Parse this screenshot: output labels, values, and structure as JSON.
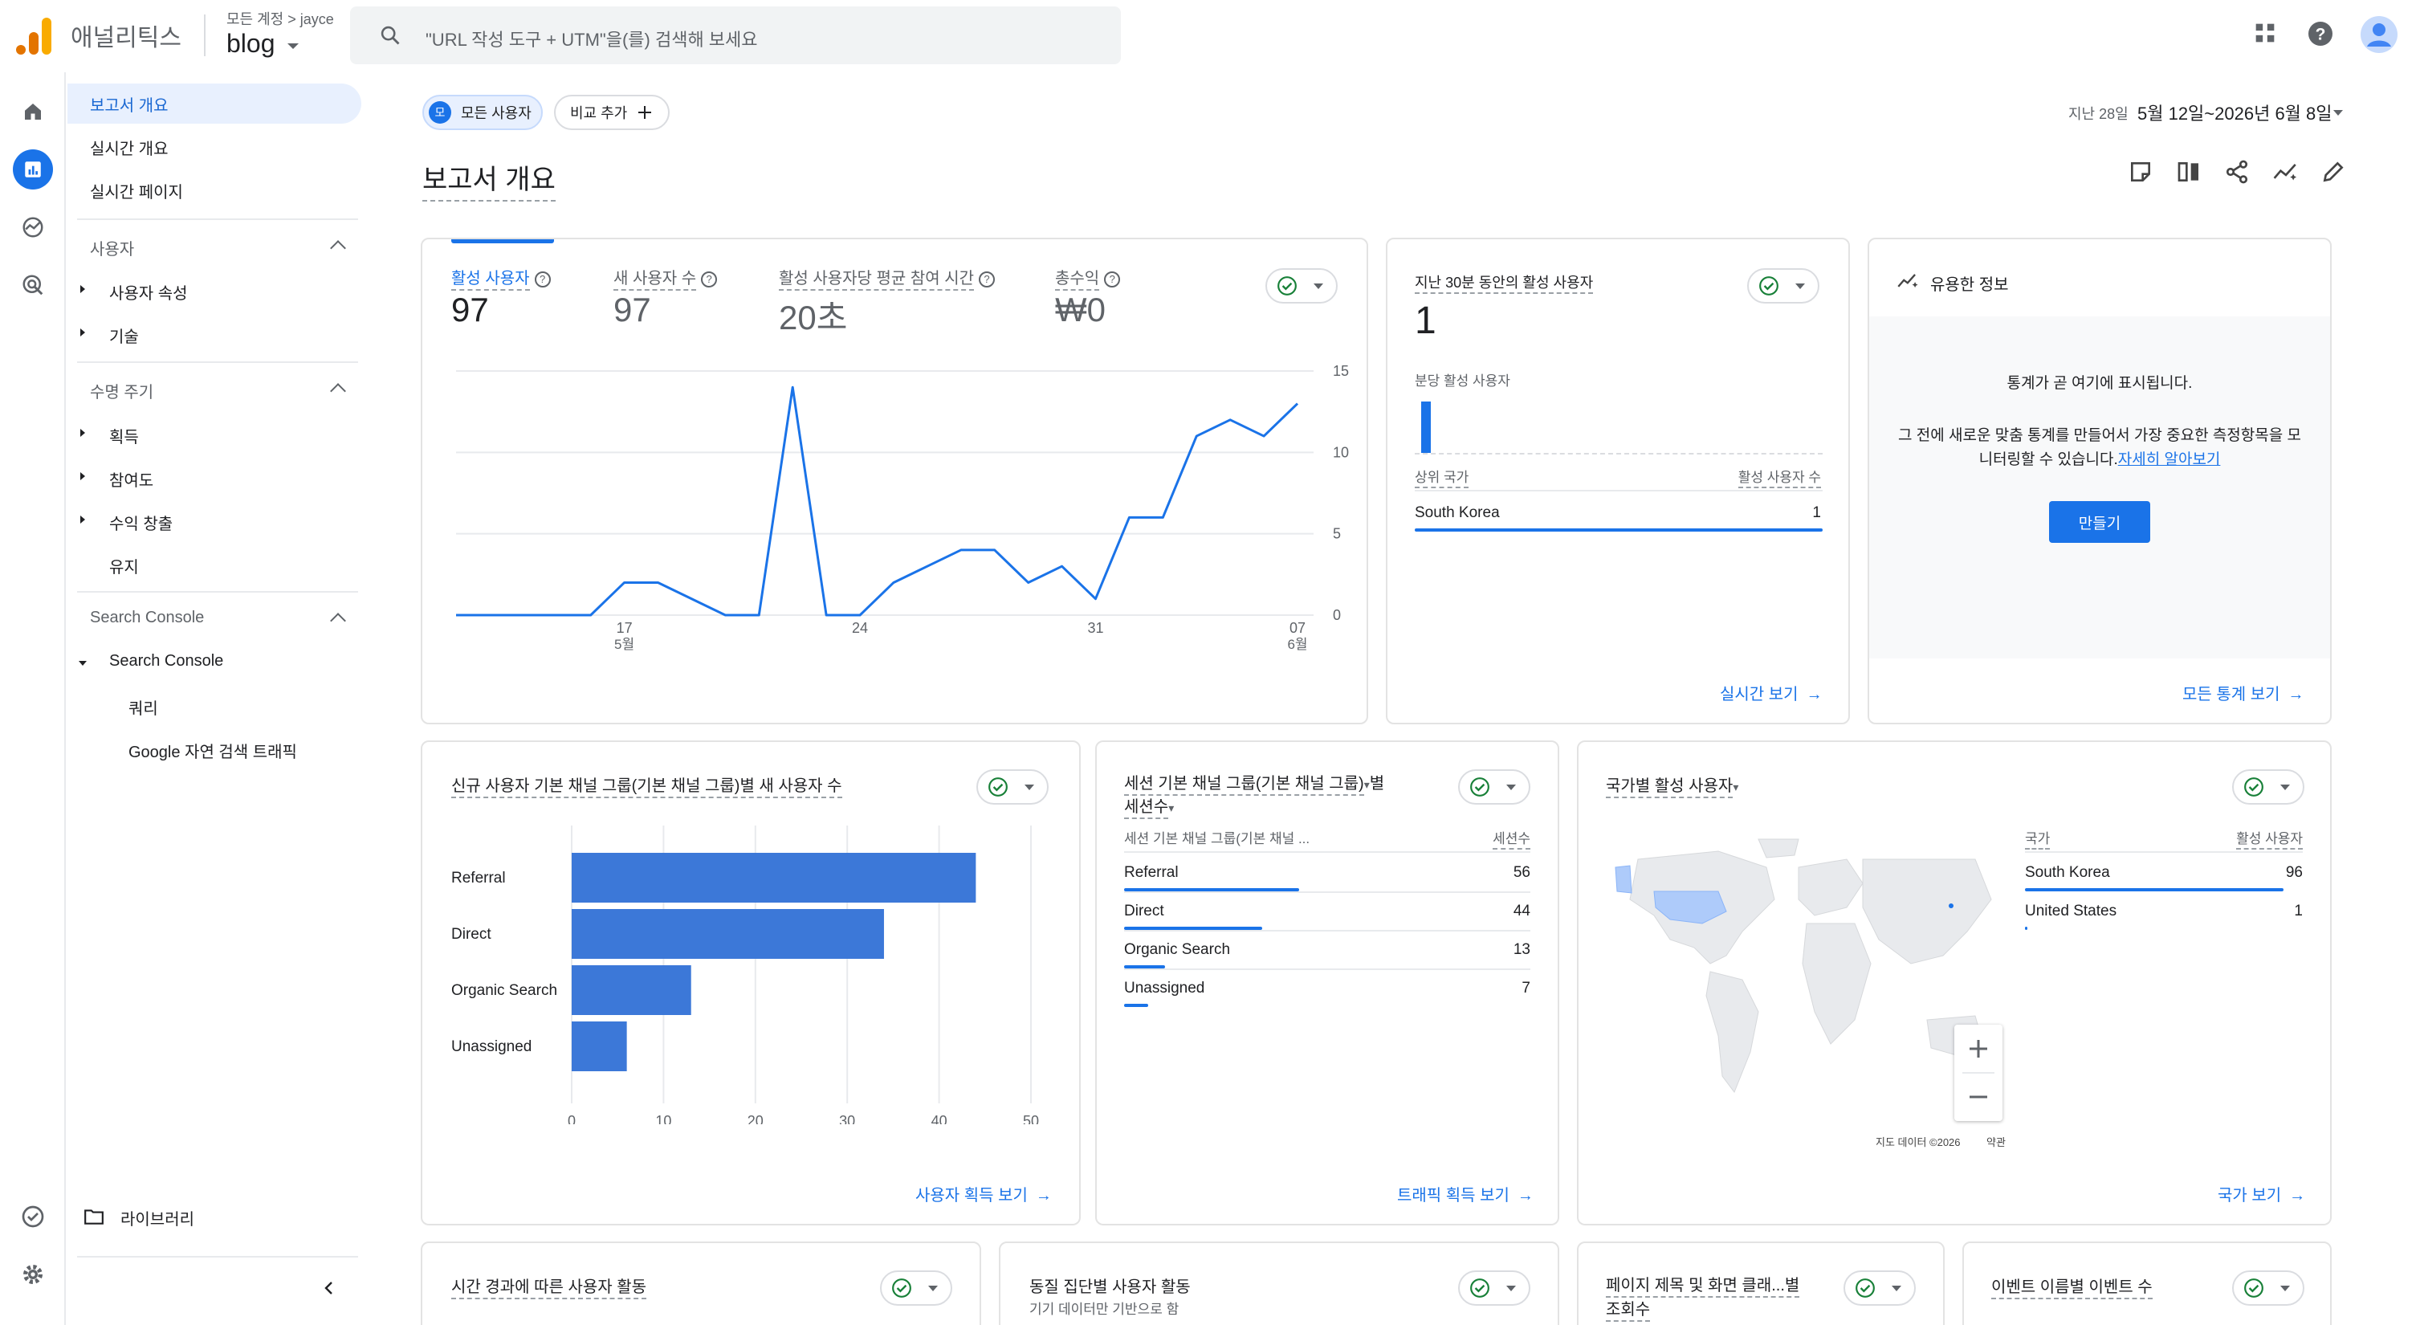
{
  "app": {
    "name": "애널리틱스",
    "account_path": "모든 계정 > jayce",
    "property": "blog"
  },
  "search": {
    "placeholder": "\"URL 작성 도구 + UTM\"을(를) 검색해 보세요"
  },
  "icons": {
    "apps": "apps-grid-icon",
    "help": "help-icon",
    "account": "account-avatar-icon"
  },
  "rail": [
    "home-icon",
    "reports-icon",
    "explore-icon",
    "advertising-icon"
  ],
  "nav": {
    "report_overview": "보고서 개요",
    "realtime_overview": "실시간 개요",
    "realtime_pages": "실시간 페이지",
    "users_section": "사용자",
    "user_attributes": "사용자 속성",
    "tech": "기술",
    "lifecycle_section": "수명 주기",
    "acquisition": "획득",
    "engagement": "참여도",
    "monetization": "수익 창출",
    "retention": "유지",
    "sc_section": "Search Console",
    "sc_item": "Search Console",
    "queries": "쿼리",
    "organic": "Google 자연 검색 트래픽",
    "library": "라이브러리"
  },
  "toolbar": {
    "segment_badge": "모",
    "segment": "모든 사용자",
    "compare": "비교 추가",
    "date_label": "지난 28일",
    "date_range": "5월 12일~2026년 6월 8일"
  },
  "page_title": "보고서 개요",
  "colors": {
    "accent": "#1a73e8",
    "check": "#188038",
    "map_highlight": "#aecbfa"
  },
  "main_card": {
    "metrics": [
      {
        "label": "활성 사용자",
        "value": "97"
      },
      {
        "label": "새 사용자 수",
        "value": "97"
      },
      {
        "label": "활성 사용자당 평균 참여 시간",
        "value": "20초"
      },
      {
        "label": "총수익",
        "value": "₩0"
      }
    ],
    "x_ticks": [
      {
        "day": "17",
        "month": "5월"
      },
      {
        "day": "24",
        "month": ""
      },
      {
        "day": "31",
        "month": ""
      },
      {
        "day": "07",
        "month": "6월"
      }
    ]
  },
  "chart_data": [
    {
      "type": "line",
      "series": [
        {
          "name": "활성 사용자",
          "values": [
            0,
            0,
            0,
            0,
            0,
            2,
            2,
            1,
            0,
            0,
            14,
            0,
            0,
            2,
            3,
            4,
            4,
            2,
            3,
            1,
            6,
            6,
            11,
            12,
            11,
            13
          ]
        }
      ],
      "x": [
        "5월 12일",
        "5월 13일",
        "5월 14일",
        "5월 15일",
        "5월 16일",
        "5월 17일",
        "5월 18일",
        "5월 19일",
        "5월 20일",
        "5월 21일",
        "5월 22일",
        "5월 23일",
        "5월 24일",
        "5월 25일",
        "5월 26일",
        "5월 27일",
        "5월 28일",
        "5월 29일",
        "5월 30일",
        "5월 31일",
        "6월 1일",
        "6월 2일",
        "6월 3일",
        "6월 4일",
        "6월 5일",
        "6월 6일"
      ],
      "ylim": [
        0,
        15
      ],
      "y_ticks": [
        "15",
        "10",
        "5",
        "0"
      ]
    },
    {
      "type": "bar",
      "title": "신규 사용자 기본 채널 그룹(기본 채널 그룹)별 새 사용자 수",
      "categories": [
        "Referral",
        "Direct",
        "Organic Search",
        "Unassigned"
      ],
      "values": [
        44,
        34,
        13,
        6
      ],
      "xlim": [
        0,
        50
      ],
      "x_ticks": [
        "0",
        "10",
        "20",
        "30",
        "40",
        "50"
      ]
    }
  ],
  "realtime": {
    "title": "지난 30분 동안의 활성 사용자",
    "value": "1",
    "per_minute": "분당 활성 사용자",
    "col_country": "상위 국가",
    "col_users": "활성 사용자 수",
    "rows": [
      {
        "country": "South Korea",
        "users": "1"
      }
    ],
    "link": "실시간 보기"
  },
  "insights": {
    "title": "유용한 정보",
    "heading": "통계가 곧 여기에 표시됩니다.",
    "body": "그 전에 새로운 맞춤 통계를 만들어서 가장 중요한 측정항목을 모니터링할 수 있습니다.",
    "learn_more": "자세히 알아보기",
    "create": "만들기",
    "link": "모든 통계 보기"
  },
  "acq_card": {
    "link": "사용자 획득 보기"
  },
  "traffic": {
    "title_line1": "세션 기본 채널 그룹(기본 채널 그룹)",
    "title_line2": "별",
    "title_line3": "세션수",
    "col_channel": "세션 기본 채널 그룹(기본 채널 ...",
    "col_sessions": "세션수",
    "rows": [
      {
        "name": "Referral",
        "value": "56",
        "frac": 0.43
      },
      {
        "name": "Direct",
        "value": "44",
        "frac": 0.34
      },
      {
        "name": "Organic Search",
        "value": "13",
        "frac": 0.1
      },
      {
        "name": "Unassigned",
        "value": "7",
        "frac": 0.06
      }
    ],
    "link": "트래픽 획득 보기"
  },
  "country": {
    "title": "국가별 활성 사용자",
    "col_country": "국가",
    "col_users": "활성 사용자",
    "rows": [
      {
        "name": "South Korea",
        "value": "96",
        "frac": 0.93
      },
      {
        "name": "United States",
        "value": "1",
        "frac": 0.01
      }
    ],
    "map_credit": "지도 데이터 ©2026",
    "map_terms": "약관",
    "link": "국가 보기"
  },
  "bottom_cards": [
    {
      "title": "시간 경과에 따른 사용자 활동",
      "subtitle": ""
    },
    {
      "title": "동질 집단별 사용자 활동",
      "subtitle": "기기 데이터만 기반으로 함"
    },
    {
      "title": "페이지 제목 및 화면 클래...별 조회수",
      "subtitle": ""
    },
    {
      "title": "이벤트 이름별 이벤트 수",
      "subtitle": ""
    }
  ]
}
